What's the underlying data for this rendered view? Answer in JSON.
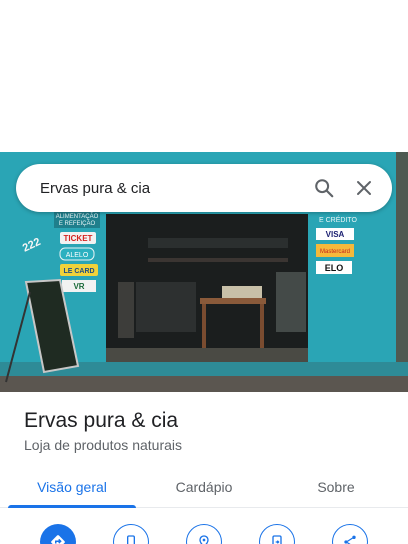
{
  "search": {
    "query": "Ervas pura & cia"
  },
  "icons": {
    "search": "search-icon",
    "close": "close-icon"
  },
  "place": {
    "name": "Ervas pura & cia",
    "category": "Loja de produtos naturais"
  },
  "tabs": [
    {
      "label": "Visão geral",
      "active": true
    },
    {
      "label": "Cardápio",
      "active": false
    },
    {
      "label": "Sobre",
      "active": false
    }
  ],
  "actions": [
    {
      "icon": "directions-icon"
    },
    {
      "icon": "phone-icon"
    },
    {
      "icon": "nearby-icon"
    },
    {
      "icon": "send-to-phone-icon"
    },
    {
      "icon": "share-icon"
    }
  ],
  "photo": {
    "number": "222",
    "left_signs": [
      "ALIMENTAÇÃO E REFEIÇÃO",
      "TICKET",
      "ALELO",
      "LE CARD",
      "VR"
    ],
    "right_signs": [
      "E CRÉDITO",
      "VISA",
      "Mastercard",
      "ELO"
    ]
  },
  "colors": {
    "accent": "#1a73e8",
    "wall": "#2aa5b5"
  }
}
